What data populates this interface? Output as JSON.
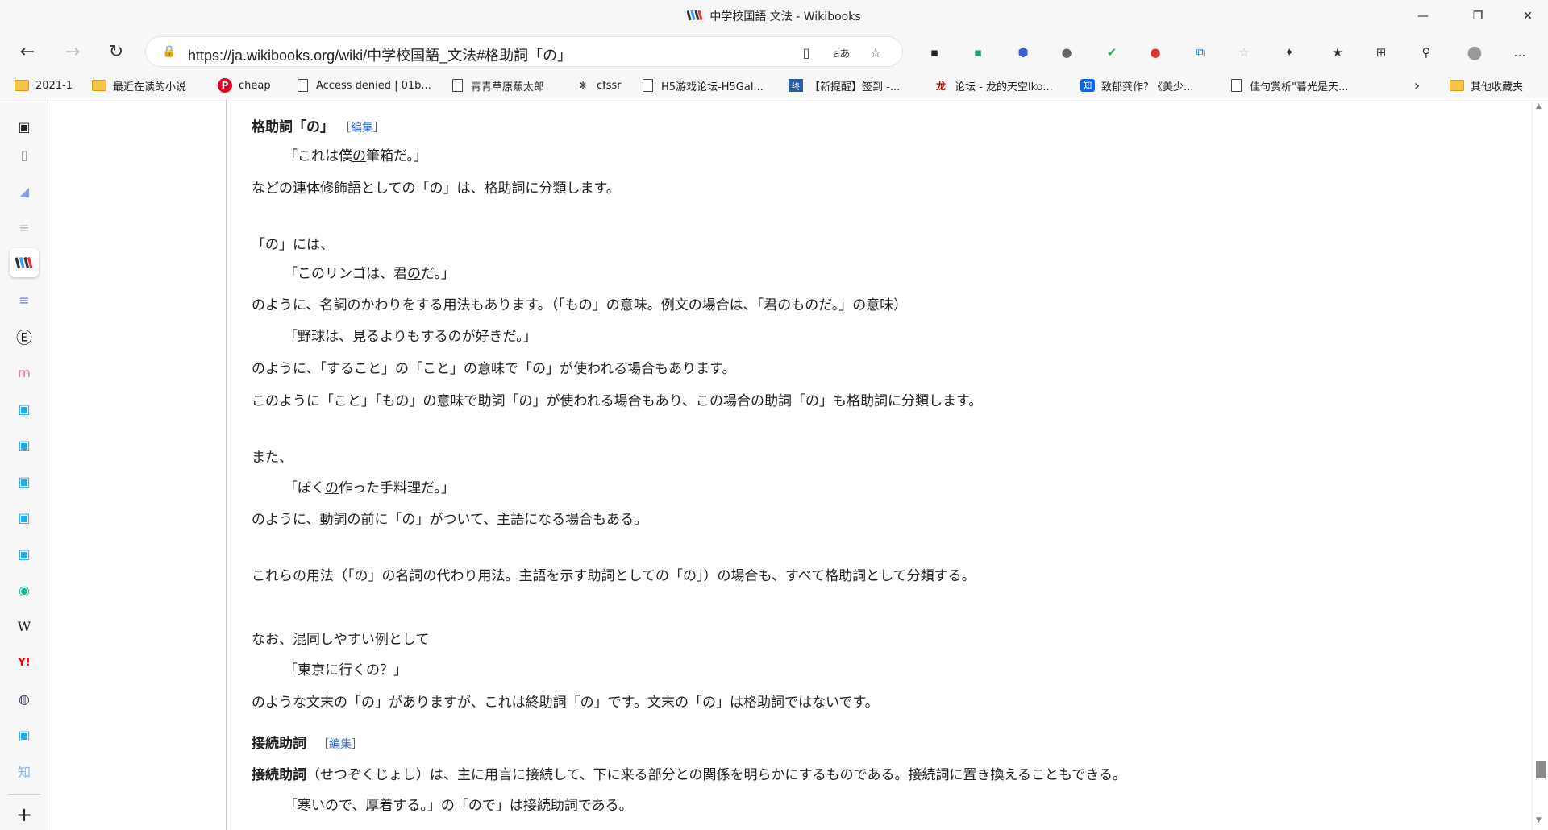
{
  "window": {
    "title": "中学校国語 文法 - Wikibooks",
    "minimize": "—",
    "restore": "❐",
    "close": "✕"
  },
  "nav": {
    "back": "←",
    "forward": "→",
    "refresh": "↻",
    "url": "https://ja.wikibooks.org/wiki/中学校国語_文法#格助詞「の」",
    "lock": "🔒",
    "reader_icon": "▯",
    "read_aloud_icon": "aあ",
    "add_favorite_icon": "☆"
  },
  "extensions": [
    "▪",
    "▪",
    "⬢",
    "●",
    "✔",
    "●",
    "⧉",
    "☆",
    "✦",
    "★",
    "⊞",
    "⚲",
    "●",
    "…"
  ],
  "bookmarks": [
    {
      "icon": "folder",
      "label": "2021-1"
    },
    {
      "icon": "folder",
      "label": "最近在读的小说"
    },
    {
      "icon": "p",
      "label": "cheap"
    },
    {
      "icon": "page",
      "label": "Access denied | 01b..."
    },
    {
      "icon": "page",
      "label": "青青草原蕉太郎"
    },
    {
      "icon": "bee",
      "label": "cfssr"
    },
    {
      "icon": "page",
      "label": "H5游戏论坛-H5Gal..."
    },
    {
      "icon": "终",
      "label": "【新提醒】签到 -..."
    },
    {
      "icon": "龙",
      "label": "论坛 - 龙的天空lko..."
    },
    {
      "icon": "知",
      "label": "致郁龚作? 《美少..."
    },
    {
      "icon": "page",
      "label": "佳句赏析\"暮光是天..."
    },
    {
      "icon": "more",
      "label": "›"
    },
    {
      "icon": "folder",
      "label": "其他收藏夹"
    }
  ],
  "sidebar": {
    "items": [
      "▣",
      "▯",
      "◢",
      "≡",
      "W",
      "≡",
      "Ⓔ",
      "m",
      "▣",
      "▣",
      "▣",
      "▣",
      "▣",
      "◉",
      "W",
      "Y!",
      "◍",
      "▣",
      "知"
    ],
    "add": "+"
  },
  "article": {
    "h1": "格助詞「の」",
    "edit_open": "［",
    "edit_label": "編集",
    "edit_close": "］",
    "p1_a": "「これは僕",
    "p1_u": "の",
    "p1_b": "筆箱だ。」",
    "p2": "などの連体修飾語としての「の」は、格助詞に分類します。",
    "p3": "「の」には、",
    "p4_a": "「このリンゴは、君",
    "p4_u": "の",
    "p4_b": "だ。」",
    "p5": "のように、名詞のかわりをする用法もあります。（「もの」の意味。例文の場合は、「君のものだ。」の意味）",
    "p6_a": "「野球は、見るよりもする",
    "p6_u": "の",
    "p6_b": "が好きだ。」",
    "p7": "のように、「すること」の「こと」の意味で「の」が使われる場合もあります。",
    "p8": "このように「こと」「もの」の意味で助詞「の」が使われる場合もあり、この場合の助詞「の」も格助詞に分類します。",
    "p9": "また、",
    "p10_a": "「ぼく",
    "p10_u": "の",
    "p10_b": "作った手料理だ。」",
    "p11": "のように、動詞の前に「の」がついて、主語になる場合もある。",
    "p12": "これらの用法（「の」の名詞の代わり用法。主語を示す助詞としての「の」）の場合も、すべて格助詞として分類する。",
    "p13": "なお、混同しやすい例として",
    "p14": "「東京に行くの？」",
    "p15": "のような文末の「の」がありますが、これは終助詞「の」です。文末の「の」は格助詞ではないです。",
    "h2": "接続助詞",
    "p16_bold": "接続助詞",
    "p16": "（せつぞくじょし）は、主に用言に接続して、下に来る部分との関係を明らかにするものである。接続詞に置き換えることもできる。",
    "p17_a": "「寒い",
    "p17_u": "ので",
    "p17_b": "、厚着する。」の「ので」は接続助詞である。"
  }
}
